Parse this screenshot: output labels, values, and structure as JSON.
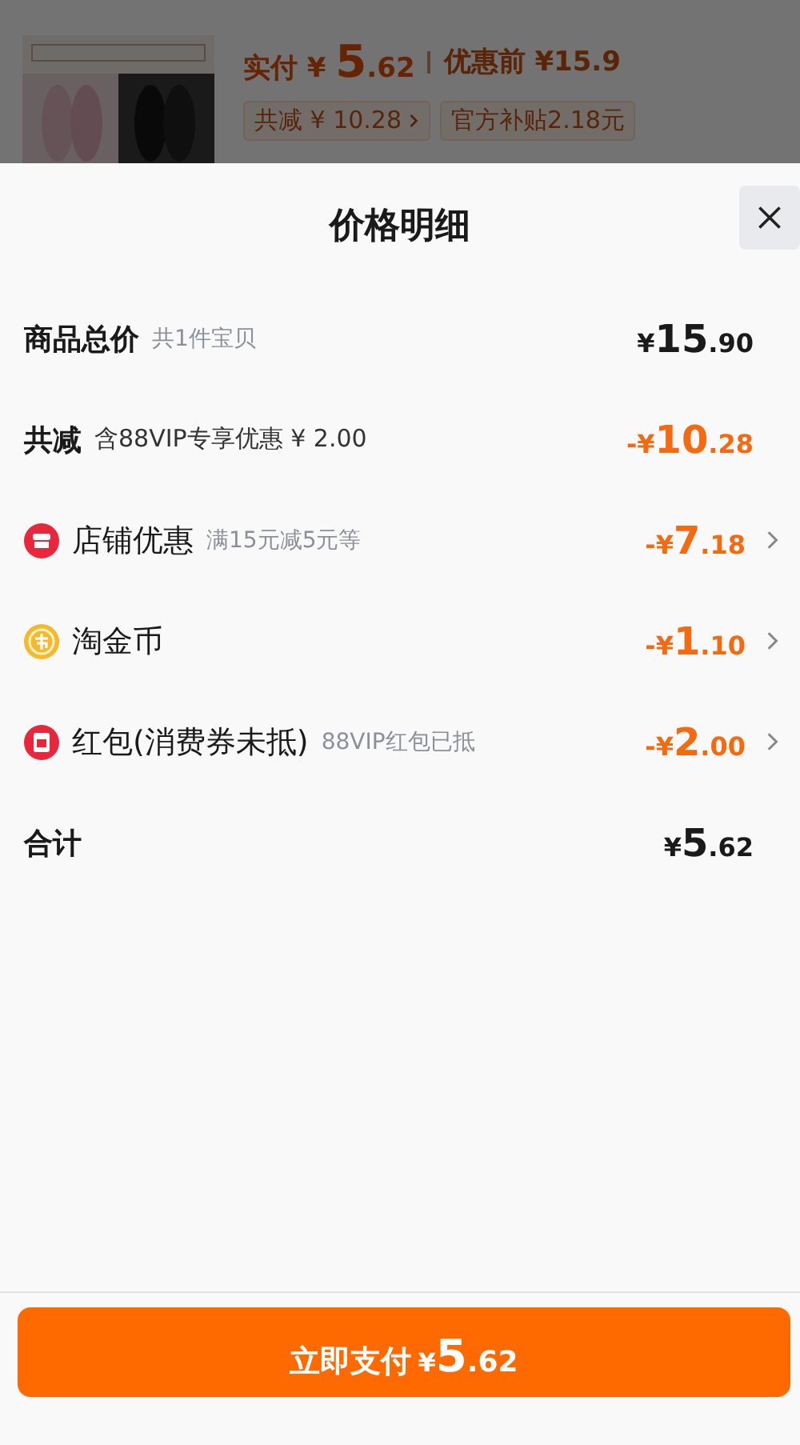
{
  "header": {
    "paid_label": "实付",
    "paid_price": {
      "sign": "¥",
      "int": "5",
      "dec": ".62"
    },
    "original_label": "优惠前",
    "original_price": "¥15.9",
    "chips": [
      {
        "text": "共减 ¥ 10.28",
        "chevron": true
      },
      {
        "text": "官方补贴2.18元",
        "chevron": false
      }
    ]
  },
  "sheet": {
    "title": "价格明细",
    "rows": [
      {
        "kind": "total",
        "label": "商品总价",
        "note": "共1件宝贝",
        "amount": {
          "sign": "¥",
          "int": "15",
          "dec": ".90"
        },
        "discount": false
      },
      {
        "kind": "total",
        "label": "共减",
        "note": "含88VIP专享优惠 ¥ 2.00",
        "amount": {
          "sign": "-¥",
          "int": "10",
          "dec": ".28"
        },
        "discount": true
      },
      {
        "kind": "detail",
        "label": "店铺优惠",
        "note": "满15元减5元等",
        "amount": {
          "sign": "-¥",
          "int": "7",
          "dec": ".18"
        },
        "discount": true
      },
      {
        "kind": "detail",
        "label": "淘金币",
        "amount": {
          "sign": "-¥",
          "int": "1",
          "dec": ".10"
        },
        "discount": true
      },
      {
        "kind": "detail",
        "label": "红包(消费券未抵)",
        "note": "88VIP红包已抵",
        "amount": {
          "sign": "-¥",
          "int": "2",
          "dec": ".00"
        },
        "discount": true
      },
      {
        "kind": "total",
        "label": "合计",
        "amount": {
          "sign": "¥",
          "int": "5",
          "dec": ".62"
        },
        "discount": false
      }
    ]
  },
  "pay_button": {
    "label": "立即支付",
    "price": {
      "sign": "¥",
      "int": "5",
      "dec": ".62"
    }
  }
}
